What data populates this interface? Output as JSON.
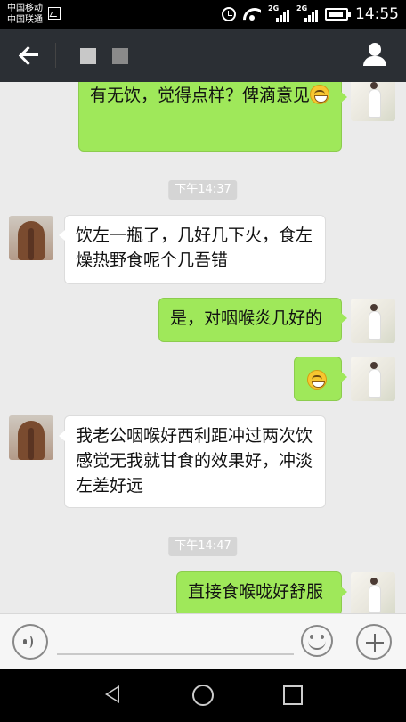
{
  "status_bar": {
    "carrier_1": "中国移动",
    "carrier_2": "中国联通",
    "network_1": "2G",
    "network_2": "2G",
    "time": "14:55"
  },
  "header": {
    "title_blocks": [
      {
        "color": "#c8c8c8"
      },
      {
        "color": "#8a8a8a"
      }
    ]
  },
  "chat": {
    "messages": [
      {
        "type": "outgoing",
        "text": "有无饮，觉得点样？俾滴意见",
        "emoji": true
      },
      {
        "type": "timestamp",
        "text": "下午14:37"
      },
      {
        "type": "incoming",
        "text": "饮左一瓶了，几好几下火，食左燥热野食呢个几吾错"
      },
      {
        "type": "outgoing",
        "text": "是，对咽喉炎几好的"
      },
      {
        "type": "outgoing",
        "text": "",
        "emoji": true
      },
      {
        "type": "incoming",
        "text": "我老公咽喉好西利距冲过两次饮感觉无我就甘食的效果好，冲淡左差好远"
      },
      {
        "type": "timestamp",
        "text": "下午14:47"
      },
      {
        "type": "outgoing",
        "text": "直接食喉咙好舒服"
      }
    ]
  },
  "input_bar": {
    "text_value": "",
    "placeholder": ""
  },
  "colors": {
    "outgoing_bubble": "#9fe85a",
    "incoming_bubble": "#ffffff",
    "chat_background": "#ebebeb",
    "header_background": "#2b2f34"
  }
}
